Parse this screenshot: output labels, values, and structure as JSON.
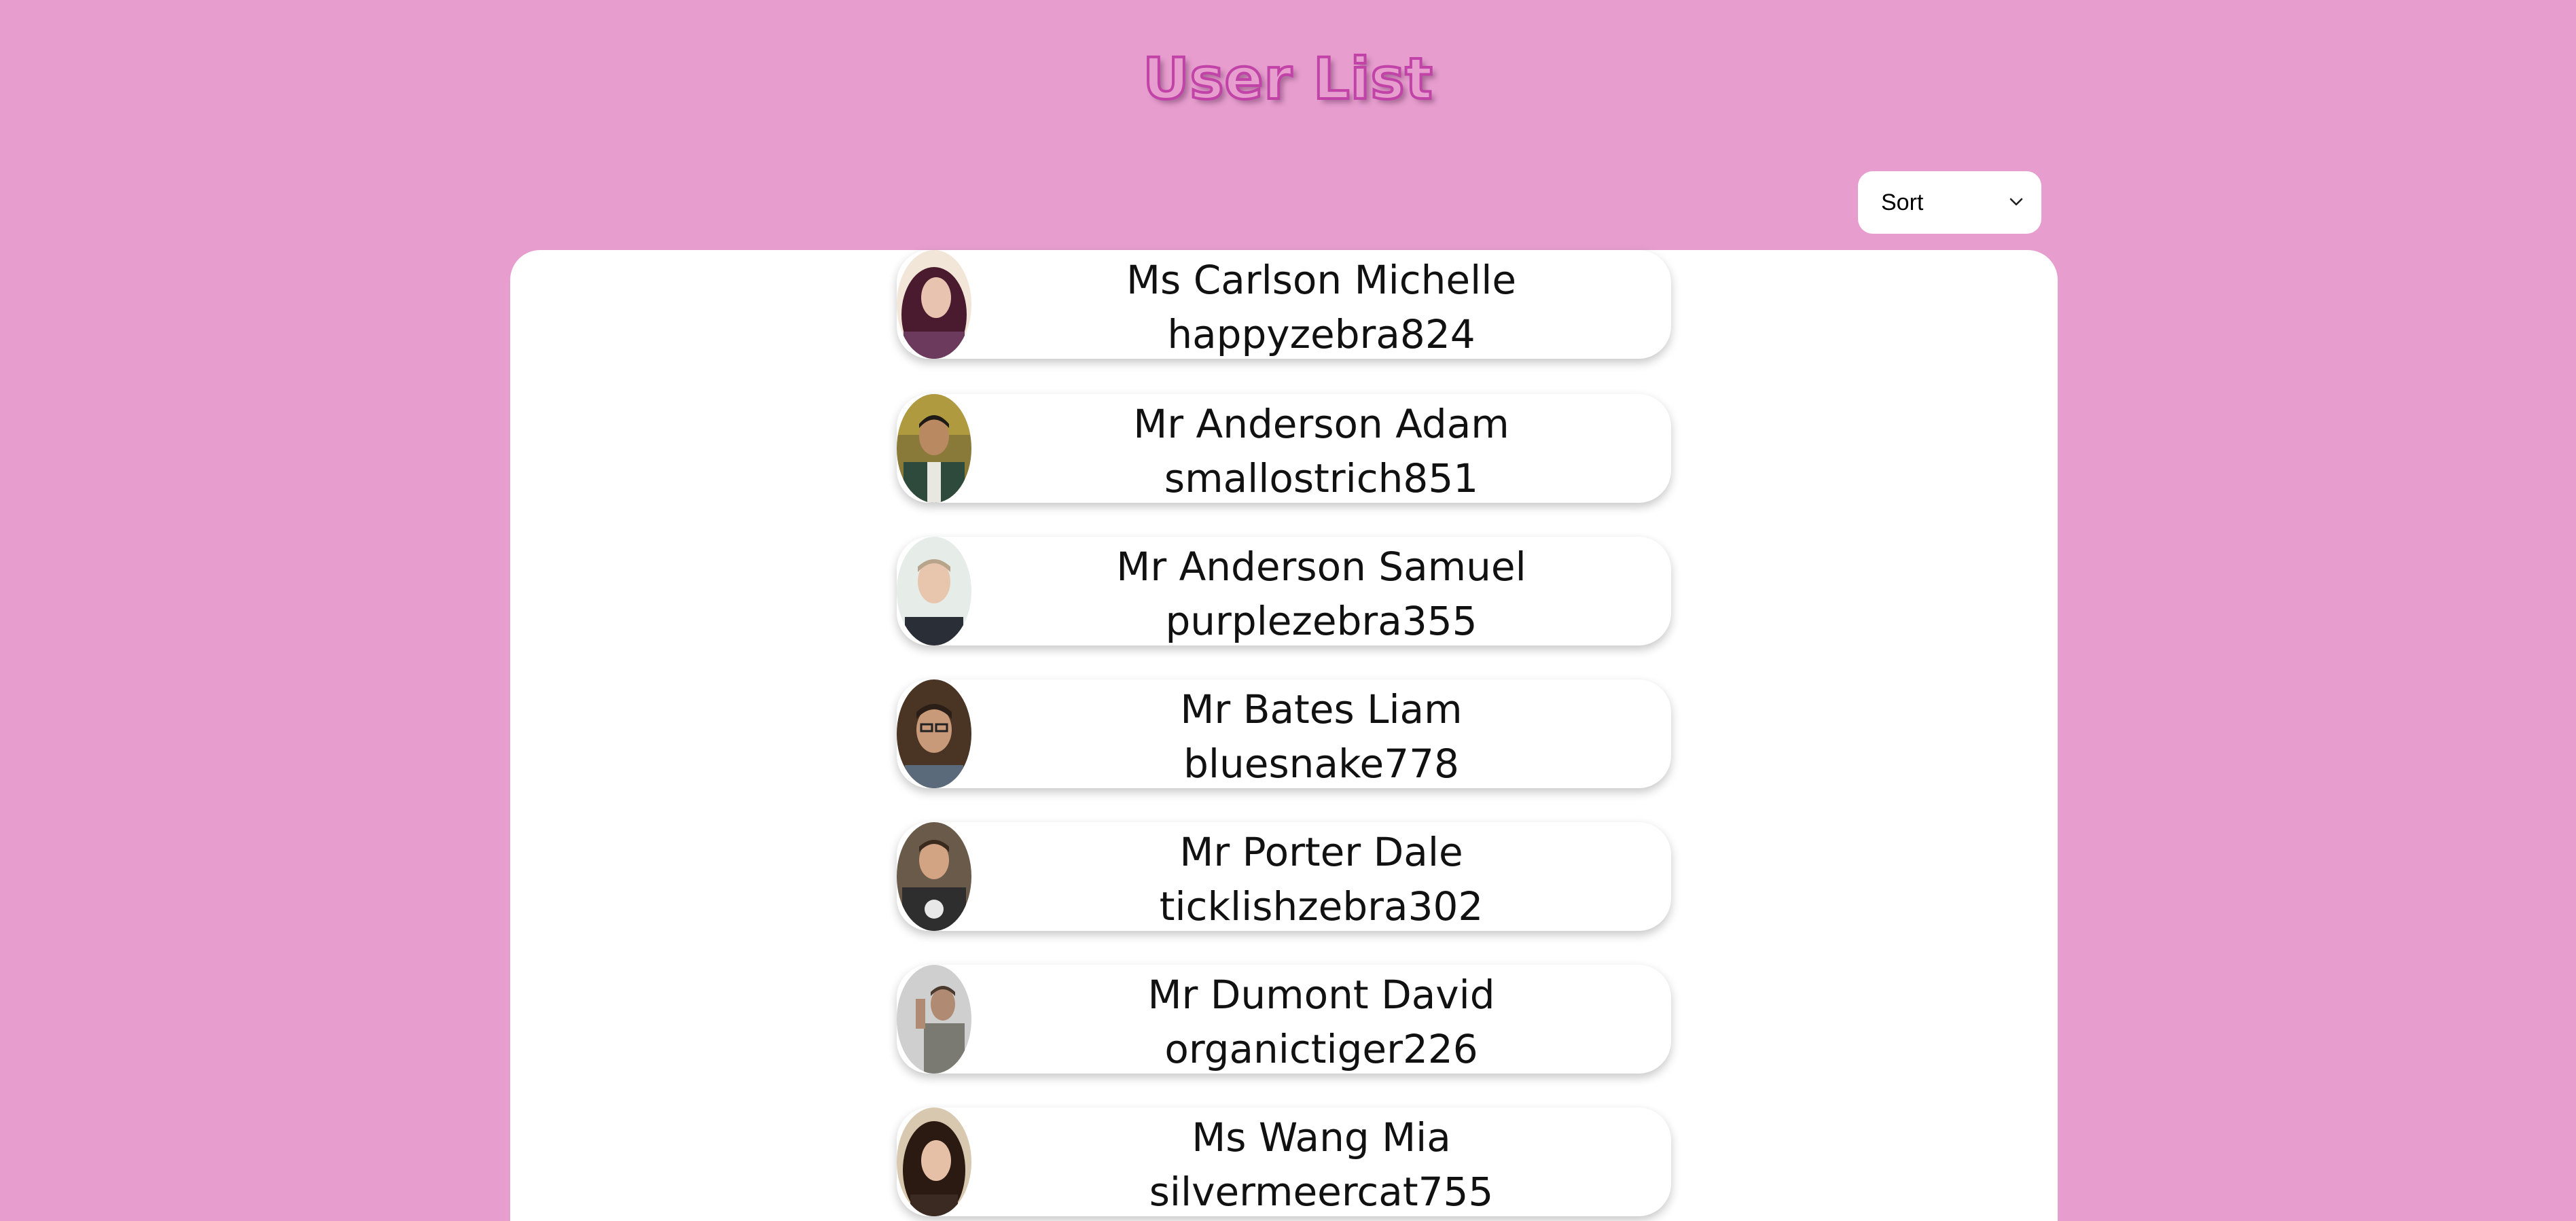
{
  "header": {
    "title": "User List"
  },
  "sort": {
    "selected": "Sort"
  },
  "colors": {
    "background": "#e79ecf",
    "title_stroke": "#c243a8",
    "panel": "#ffffff"
  },
  "users": [
    {
      "name": "Ms Carlson Michelle",
      "username": "happyzebra824"
    },
    {
      "name": "Mr Anderson Adam",
      "username": "smallostrich851"
    },
    {
      "name": "Mr Anderson Samuel",
      "username": "purplezebra355"
    },
    {
      "name": "Mr Bates Liam",
      "username": "bluesnake778"
    },
    {
      "name": "Mr Porter Dale",
      "username": "ticklishzebra302"
    },
    {
      "name": "Mr Dumont David",
      "username": "organictiger226"
    },
    {
      "name": "Ms Wang Mia",
      "username": "silvermeercat755"
    }
  ]
}
